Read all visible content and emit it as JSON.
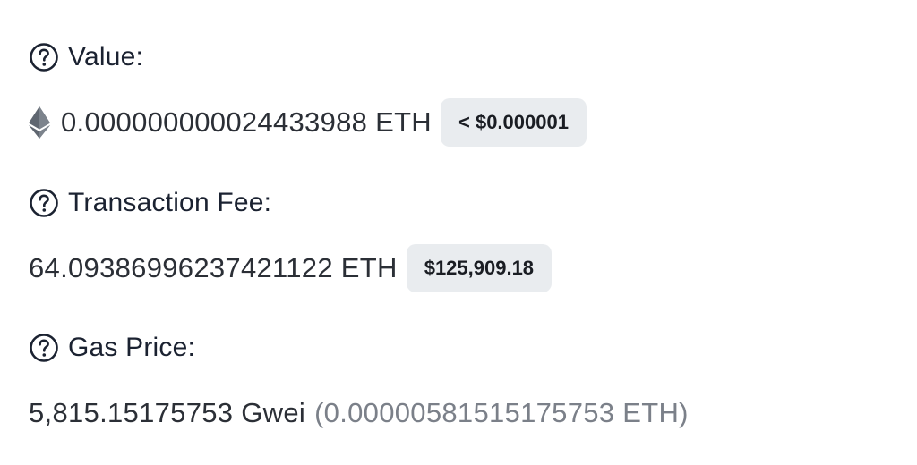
{
  "value_section": {
    "label": "Value:",
    "amount": "0.000000000024433988 ETH",
    "usd_badge": "< $0.000001",
    "help_icon": "question-circle-icon",
    "token_icon": "ethereum-icon"
  },
  "fee_section": {
    "label": "Transaction Fee:",
    "amount": "64.0938699623742112​2 ETH",
    "usd_badge": "$125,909.18",
    "help_icon": "question-circle-icon"
  },
  "gas_section": {
    "label": "Gas Price:",
    "amount": "5,815.15175753 Gwei",
    "eth_equivalent": "(0.00000581515175753 ETH)",
    "help_icon": "question-circle-icon"
  },
  "colors": {
    "text_primary": "#1b2231",
    "text_muted": "#7b8089",
    "badge_bg": "#e9ecef"
  }
}
